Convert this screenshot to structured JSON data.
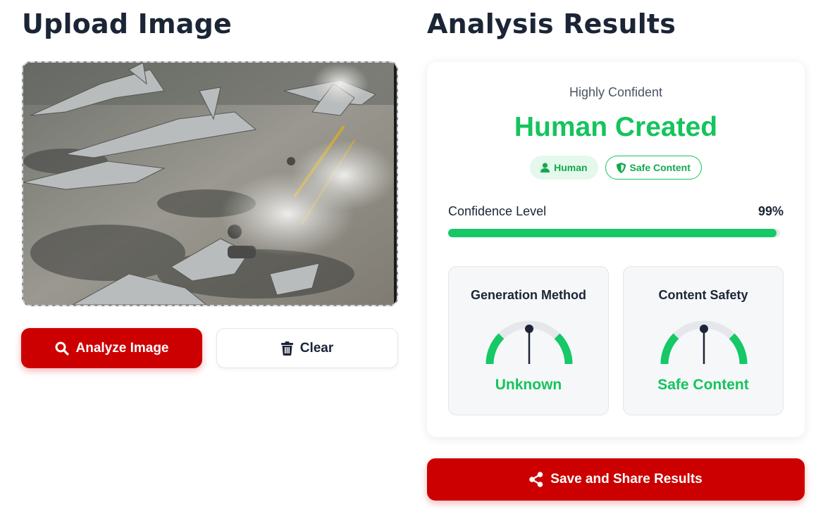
{
  "upload": {
    "title": "Upload Image",
    "analyze_label": "Analyze Image",
    "clear_label": "Clear",
    "analyze_icon": "search-icon",
    "clear_icon": "trash-icon"
  },
  "results": {
    "title": "Analysis Results",
    "confidence_label": "Highly Confident",
    "verdict": "Human Created",
    "badges": [
      {
        "label": "Human",
        "icon": "user-icon"
      },
      {
        "label": "Safe Content",
        "icon": "shield-icon"
      }
    ],
    "confidence": {
      "label": "Confidence Level",
      "value_text": "99%",
      "fraction": 0.99
    },
    "metrics": [
      {
        "title": "Generation Method",
        "value": "Unknown",
        "needle_fraction": 0.5
      },
      {
        "title": "Content Safety",
        "value": "Safe Content",
        "needle_fraction": 0.5
      }
    ],
    "share_label": "Save and Share Results",
    "share_icon": "share-icon"
  },
  "colors": {
    "brand_red": "#cc0000",
    "success_green": "#14c45c",
    "heading_dark": "#1b2536"
  }
}
